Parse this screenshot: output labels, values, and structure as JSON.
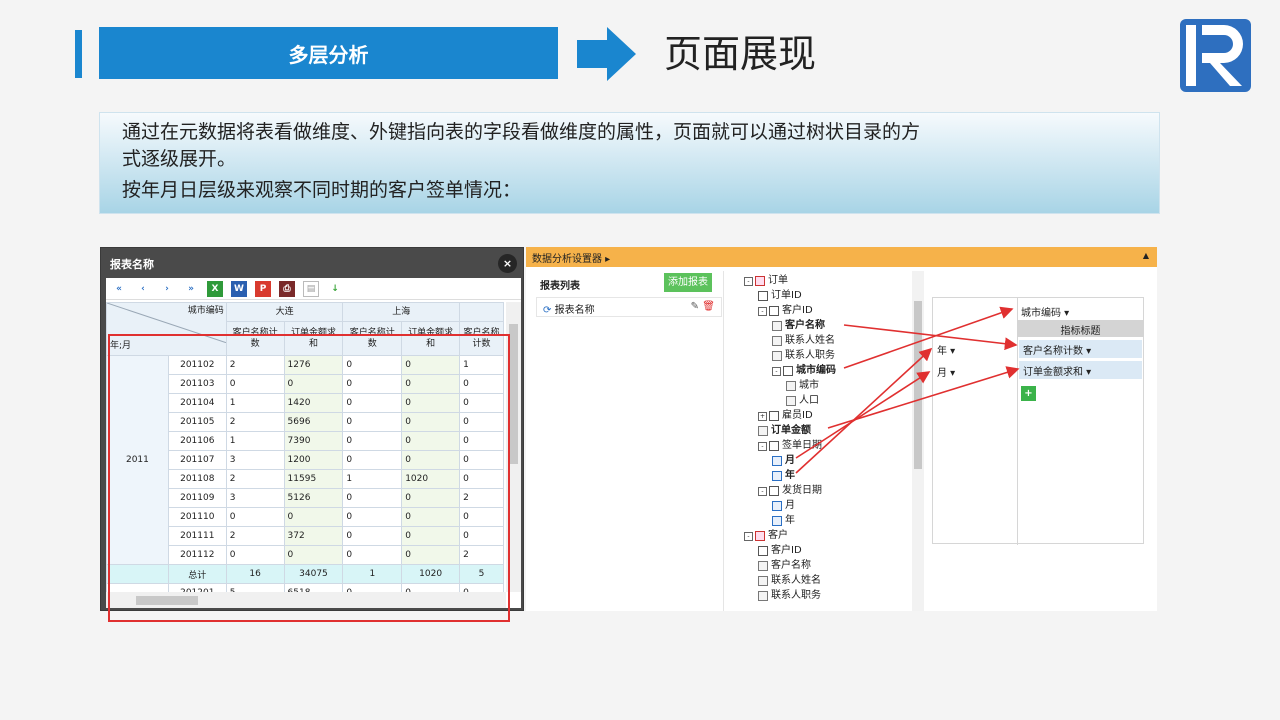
{
  "section_label": "多层分析",
  "page_title": "页面展现",
  "description": {
    "line1": "通过在元数据将表看做维度、外键指向表的字段看做维度的属性，页面就可以通过树状目录的方",
    "line2": "式逐级展开。",
    "line3": "按年月日层级来观察不同时期的客户签单情况："
  },
  "report": {
    "title": "报表名称",
    "close_label": "×",
    "corner_top": "城市编码",
    "corner_bottom": "年;月",
    "cities": [
      "大连",
      "上海"
    ],
    "measures": [
      "客户名称计数",
      "订单金额求和",
      "客户名称计数",
      "订单金额求和",
      "客户名称计数"
    ],
    "year": "2011",
    "rows": [
      [
        "201102",
        "2",
        "1276",
        "0",
        "0",
        "1"
      ],
      [
        "201103",
        "0",
        "0",
        "0",
        "0",
        "0"
      ],
      [
        "201104",
        "1",
        "1420",
        "0",
        "0",
        "0"
      ],
      [
        "201105",
        "2",
        "5696",
        "0",
        "0",
        "0"
      ],
      [
        "201106",
        "1",
        "7390",
        "0",
        "0",
        "0"
      ],
      [
        "201107",
        "3",
        "1200",
        "0",
        "0",
        "0"
      ],
      [
        "201108",
        "2",
        "11595",
        "1",
        "1020",
        "0"
      ],
      [
        "201109",
        "3",
        "5126",
        "0",
        "0",
        "2"
      ],
      [
        "201110",
        "0",
        "0",
        "0",
        "0",
        "0"
      ],
      [
        "201111",
        "2",
        "372",
        "0",
        "0",
        "0"
      ],
      [
        "201112",
        "0",
        "0",
        "0",
        "0",
        "2"
      ]
    ],
    "total_row": [
      "总计",
      "16",
      "34075",
      "1",
      "1020",
      "5"
    ],
    "next_row": [
      "201201",
      "5",
      "6518",
      "0",
      "0",
      "0"
    ]
  },
  "settings": {
    "title": "数据分析设置器",
    "report_list_title": "报表列表",
    "add_report": "添加报表",
    "report_item": "报表名称",
    "tree": [
      "订单",
      "订单ID",
      "客户ID",
      "客户名称",
      "联系人姓名",
      "联系人职务",
      "城市编码",
      "城市",
      "人口",
      "雇员ID",
      "订单金额",
      "签单日期",
      "月",
      "年",
      "发货日期",
      "月",
      "年",
      "客户",
      "客户ID",
      "客户名称",
      "联系人姓名",
      "联系人职务"
    ],
    "col_field": "城市编码",
    "indicator_header": "指标标题",
    "row_fields": [
      "年",
      "月"
    ],
    "measures": [
      "客户名称计数",
      "订单金额求和"
    ],
    "add_symbol": "+"
  },
  "colors": {
    "accent": "#1a86cf",
    "header_orange": "#f6b24a",
    "highlight_red": "#e03030",
    "add_green": "#5cc25c"
  }
}
